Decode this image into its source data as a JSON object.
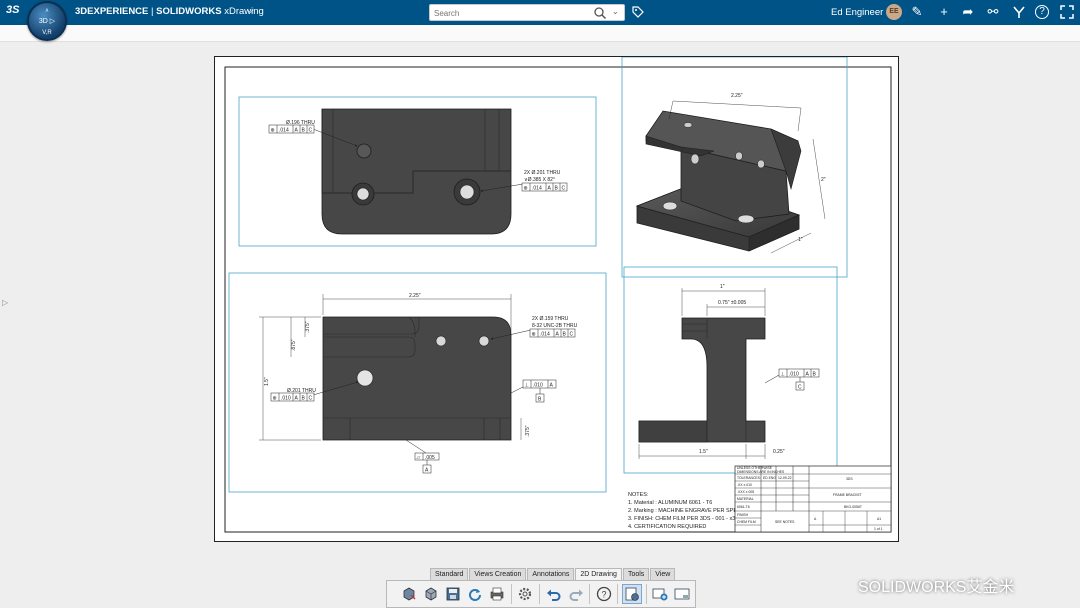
{
  "header": {
    "logo": "3S",
    "title_brand": "3DEXPERIENCE",
    "title_sep": " | ",
    "title_product": "SOLIDWORKS",
    "title_app": " xDrawing",
    "compass_top": "∧",
    "compass_mid": "3D ▷",
    "compass_bottom": "V,R",
    "search_placeholder": "Search",
    "user_name": "Ed Engineer",
    "user_initials": "EE"
  },
  "drawing": {
    "top_view": {
      "hole_note_1": "Ø.196 THRU",
      "fcf_1": [
        "⊕",
        ".014",
        "A",
        "B",
        "C"
      ],
      "hole_note_2a": "2X Ø.201 THRU",
      "hole_note_2b": "∨Ø.385 X 82°",
      "fcf_2": [
        "⊕",
        ".014",
        "A",
        "B",
        "C"
      ]
    },
    "iso_view": {
      "dim_top": "2.25\"",
      "dim_right": "2\"",
      "dim_bottom": "1\""
    },
    "front_view": {
      "dim_width": "2.25\"",
      "dim_left_outer": "1.5\"",
      "dim_left_inner": ".875\"",
      "dim_left_top": ".375\"",
      "dim_right_bottom": ".375\"",
      "hole_note_1a": "2X Ø.159 THRU",
      "hole_note_1b": "8-32 UNC-2B THRU",
      "fcf_1": [
        "⊕",
        ".014",
        "A",
        "B",
        "C"
      ],
      "hole_note_2": "Ø.201 THRU",
      "fcf_2": [
        "⊕",
        ".010",
        "A",
        "B",
        "C"
      ],
      "fcf_3": [
        "⊥",
        ".010",
        "A"
      ],
      "datum_b": "B",
      "fcf_4": [
        "▱",
        ".005"
      ],
      "datum_a": "A"
    },
    "side_view": {
      "dim_top": "1\"",
      "dim_mid": "0.75\" ±0.005",
      "dim_bottom_left": "1.5\"",
      "dim_bottom_right": "0.25\"",
      "fcf_1": [
        "⊥",
        ".010",
        "A",
        "B"
      ],
      "datum_c": "C"
    },
    "notes": {
      "heading": "NOTES:",
      "items": [
        "1. Material : ALUMINUM 6061 - T6",
        "2. Marking : MACHINE ENGRAVE PER SPEC",
        "3. FINISH: CHEM FILM PER 3DS - 001 - x3",
        "4. CERTIFICATION REQUIRED"
      ]
    },
    "title_block": {
      "left_rows": [
        "UNLESS OTHERWISE",
        "DIMENSIONS ARE IN INCHES",
        "TOLERANCES:",
        ".XX ±.010",
        ".XXX ±.005",
        "MATERIAL",
        "6061-T6",
        "FINISH",
        "CHEM FILM"
      ],
      "drawn": "ED ENG",
      "date": "12-09-22",
      "company": "3DS",
      "part_title": "FRAME BRACKET",
      "dwg_no": "BKG-0056T",
      "size": "A",
      "scale_label": "SEE NOTES",
      "rev": "A1",
      "sheet": "1 of 1"
    }
  },
  "toolbar": {
    "tabs": [
      "Standard",
      "Views Creation",
      "Annotations",
      "2D Drawing",
      "Tools",
      "View"
    ],
    "active_tab": "2D Drawing"
  },
  "watermark": "SOLIDWORKS艾金米",
  "colors": {
    "header_bg": "#005386",
    "view_frame": "#4aa3c8",
    "part_fill": "#474747",
    "part_edge": "#1e1e1e"
  }
}
